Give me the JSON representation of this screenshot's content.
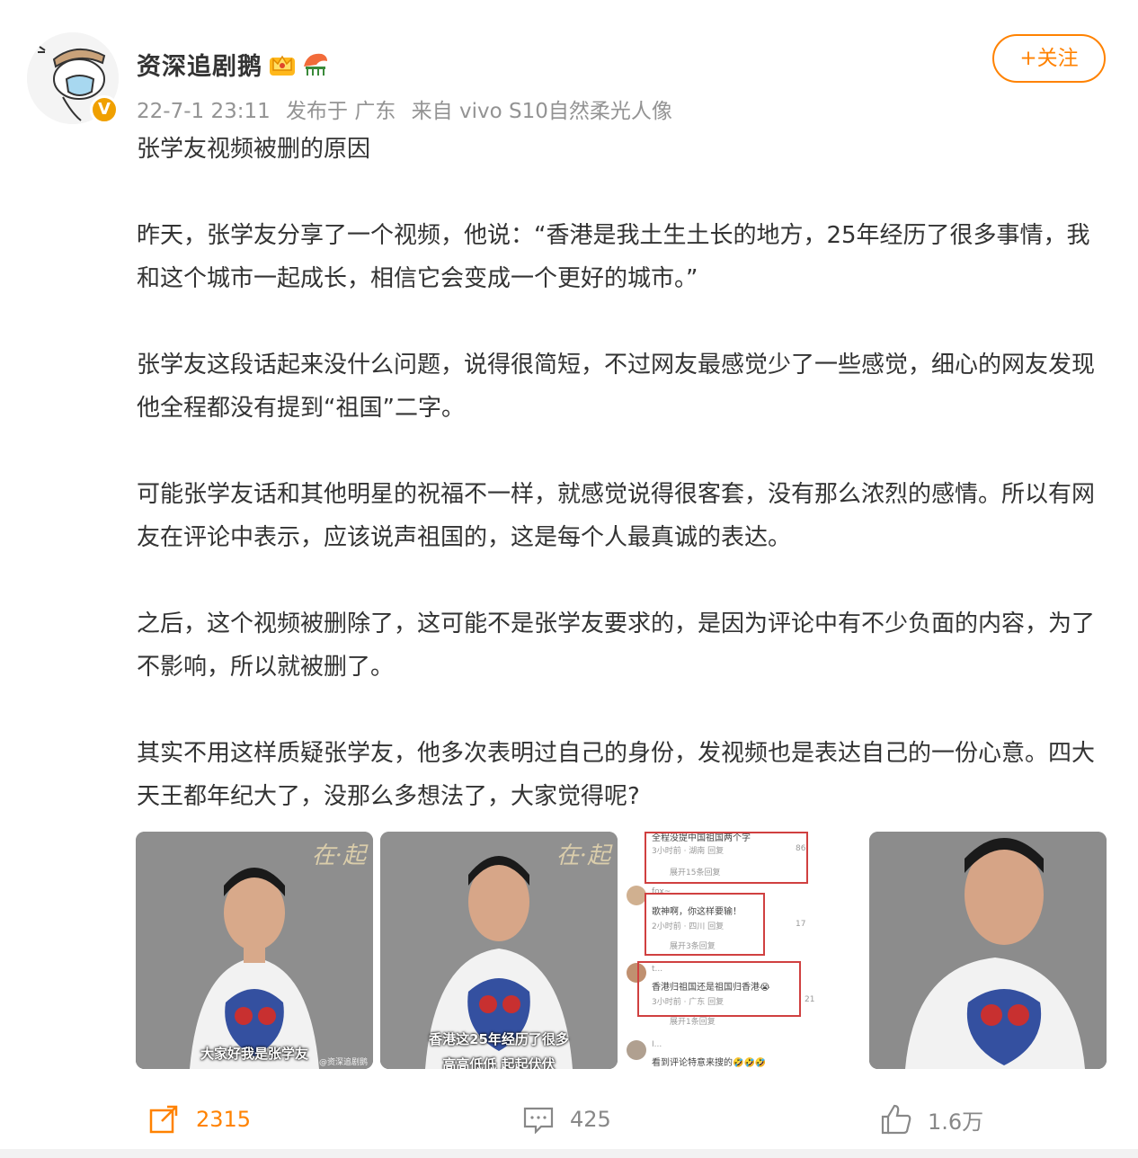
{
  "user": {
    "name": "资深追剧鹅",
    "verified_icon": "verified-v-icon",
    "badges": [
      "crown-icon",
      "bird-icon"
    ]
  },
  "meta": {
    "time": "22-7-1 23:11",
    "location": "发布于 广东",
    "source": "来自 vivo S10自然柔光人像"
  },
  "follow_label": "+关注",
  "post": {
    "title": "张学友视频被删的原因",
    "paragraphs": [
      "昨天，张学友分享了一个视频，他说：“香港是我土生土长的地方，25年经历了很多事情，我和这个城市一起成长，相信它会变成一个更好的城市。”",
      "张学友这段话起来没什么问题，说得很简短，不过网友最感觉少了一些感觉，细心的网友发现他全程都没有提到“祖国”二字。",
      "可能张学友话和其他明星的祝福不一样，就感觉说得很客套，没有那么浓烈的感情。所以有网友在评论中表示，应该说声祖国的，这是每个人最真诚的表达。",
      "之后，这个视频被删除了，这可能不是张学友要求的，是因为评论中有不少负面的内容，为了不影响，所以就被删了。",
      "其实不用这样质疑张学友，他多次表明过自己的身份，发视频也是表达自己的一份心意。四大天王都年纪大了，没那么多想法了，大家觉得呢?"
    ]
  },
  "images": {
    "img1": {
      "caption": "大家好我是张学友",
      "watermark": "@资深追剧鹅"
    },
    "img2": {
      "caption_line1": "香港这25年经历了很多",
      "caption_line2": "高高低低 起起伏伏"
    },
    "img3": {
      "top_text": "全程没提中国祖国两个字",
      "c1_meta": "3小时前 · 湖南   回复",
      "c1_likes": "86",
      "c1_expand": "展开15条回复",
      "c2_user": "fox~",
      "c2_text": "歌神啊，你这样要输！",
      "c2_meta": "2小时前 · 四川   回复",
      "c2_likes": "17",
      "c2_expand": "展开3条回复",
      "c3_user": "t...",
      "c3_text": "香港归祖国还是祖国归香港😭",
      "c3_meta": "3小时前 · 广东   回复",
      "c3_likes": "21",
      "c3_expand": "展开1条回复",
      "c4_user": "I...",
      "c4_text": "看到评论特意来搜的🤣🤣🤣"
    }
  },
  "actions": {
    "share_count": "2315",
    "comment_count": "425",
    "like_count": "1.6万"
  },
  "colors": {
    "accent": "#ff8200",
    "meta": "#939393",
    "text": "#333333"
  }
}
